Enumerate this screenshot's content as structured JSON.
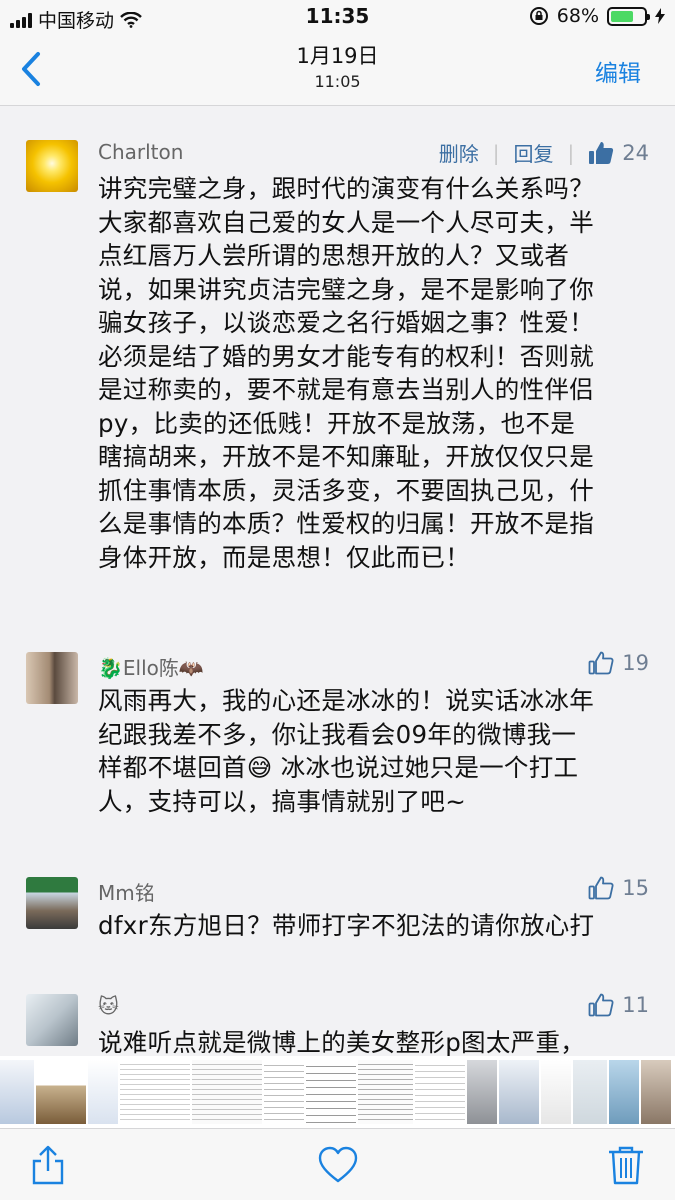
{
  "status_bar": {
    "carrier": "中国移动",
    "time": "11:35",
    "battery_percent": "68%",
    "battery_level": 0.68
  },
  "nav": {
    "back_icon": "chevron-left-icon",
    "title": "1月19日",
    "subtitle": "11:05",
    "edit_label": "编辑"
  },
  "comments": [
    {
      "username": "Charlton",
      "actions": {
        "delete": "删除",
        "reply": "回复"
      },
      "likes": "24",
      "lines": [
        "讲究完璧之身，跟时代的演变有什么关系吗？",
        "大家都喜欢自己爱的女人是一个人尽可夫，半",
        "点红唇万人尝所谓的思想开放的人？又或者",
        "说，如果讲究贞洁完璧之身，是不是影响了你",
        "骗女孩子，以谈恋爱之名行婚姻之事？性爱！",
        "必须是结了婚的男女才能专有的权利！否则就",
        "是过称卖的，要不就是有意去当别人的性伴侣",
        "py，比卖的还低贱！开放不是放荡，也不是",
        "瞎搞胡来，开放不是不知廉耻，开放仅仅只是",
        "抓住事情本质，灵活多变，不要固执己见，什",
        "么是事情的本质？性爱权的归属！开放不是指",
        "身体开放，而是思想！仅此而已！"
      ]
    },
    {
      "username": "🐉Ello陈🦇",
      "likes": "19",
      "lines": [
        "风雨再大，我的心还是冰冰的！说实话冰冰年",
        "纪跟我差不多，你让我看会09年的微博我一",
        "样都不堪回首😅 冰冰也说过她只是一个打工",
        "人，支持可以，搞事情就别了吧~"
      ]
    },
    {
      "username": "Mm铭",
      "likes": "15",
      "lines": [
        "dfxr东方旭日？带师打字不犯法的请你放心打"
      ]
    },
    {
      "username": "🐱",
      "likes": "11",
      "lines": [
        "说难听点就是微博上的美女整形p图太严重，"
      ]
    }
  ],
  "toolbar": {
    "share_icon": "share-icon",
    "like_icon": "heart-icon",
    "delete_icon": "trash-icon"
  },
  "colors": {
    "accent": "#1a82e0",
    "action_link": "#3c6fa3",
    "like_blue": "#6f7e92",
    "battery_green": "#4cd964"
  }
}
